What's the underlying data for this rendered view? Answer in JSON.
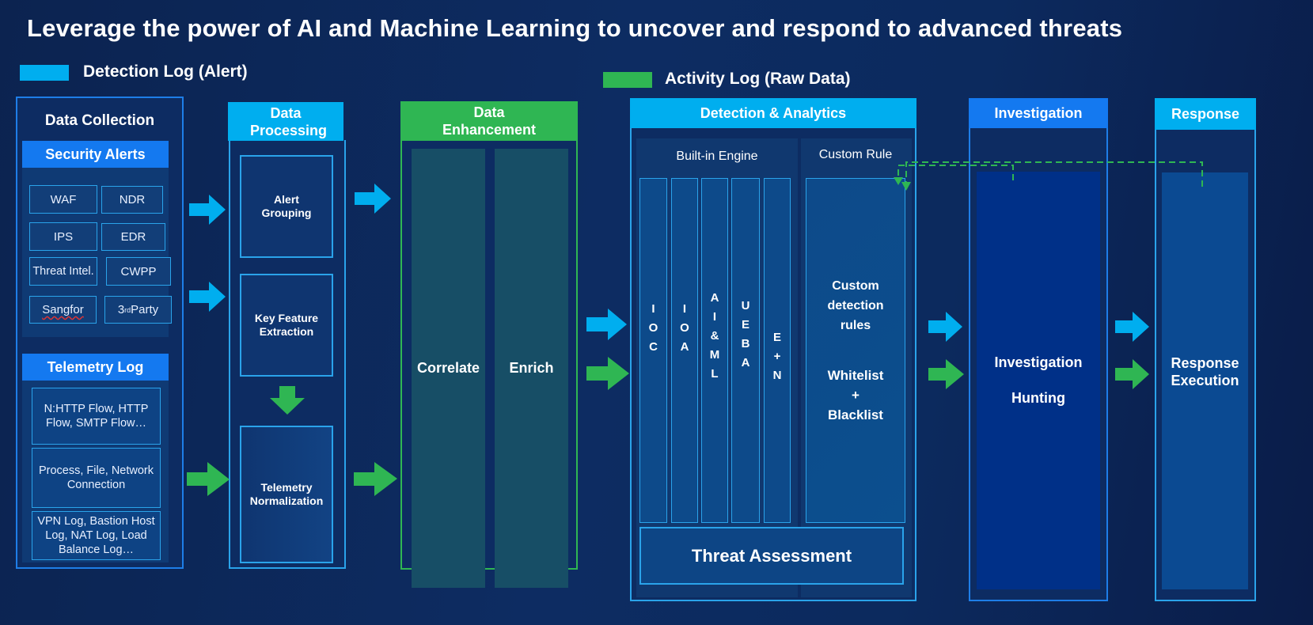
{
  "title": "Leverage the power of AI and Machine Learning to uncover and respond to advanced threats",
  "legend": [
    {
      "label": "Detection Log (Alert)",
      "color": "#00aeef"
    },
    {
      "label": "Activity Log (Raw Data)",
      "color": "#2fb653"
    }
  ],
  "data_collection": {
    "title": "Data Collection",
    "security_alerts": {
      "title": "Security Alerts",
      "items": [
        "WAF",
        "NDR",
        "IPS",
        "EDR",
        "Threat Intel.",
        "CWPP",
        "Sangfor",
        "3rd Party"
      ]
    },
    "telemetry_log": {
      "title": "Telemetry Log",
      "items": [
        "N:HTTP Flow, HTTP Flow, SMTP Flow…",
        "Process, File, Network Connection",
        "VPN Log, Bastion Host Log, NAT Log, Load Balance Log…"
      ]
    }
  },
  "data_processing": {
    "title": "Data Processing",
    "steps": [
      "Alert Grouping",
      "Key Feature Extraction",
      "Telemetry Normalization"
    ]
  },
  "data_enhancement": {
    "title": "Data Enhancement",
    "steps": [
      "Correlate",
      "Enrich"
    ]
  },
  "detection_analytics": {
    "title": "Detection & Analytics",
    "builtin_engine": {
      "title": "Built-in Engine",
      "columns": [
        [
          "I",
          "O",
          "C"
        ],
        [
          "I",
          "O",
          "A"
        ],
        [
          "A",
          "I",
          "&",
          "M",
          "L"
        ],
        [
          "U",
          "E",
          "B",
          "A"
        ],
        [
          "E",
          "+",
          "N"
        ]
      ]
    },
    "custom_rule": {
      "title": "Custom Rule",
      "line1": "Custom detection rules",
      "line2": "Whitelist + Blacklist"
    },
    "threat_assessment": "Threat Assessment"
  },
  "investigation": {
    "title": "Investigation",
    "items": [
      "Investigation",
      "Hunting"
    ]
  },
  "response": {
    "title": "Response",
    "item": "Response Execution"
  },
  "colors": {
    "detection_blue": "#00aeef",
    "activity_green": "#2fb653",
    "header_blue": "#1479f0",
    "panel_border": "#1e7ee8"
  }
}
